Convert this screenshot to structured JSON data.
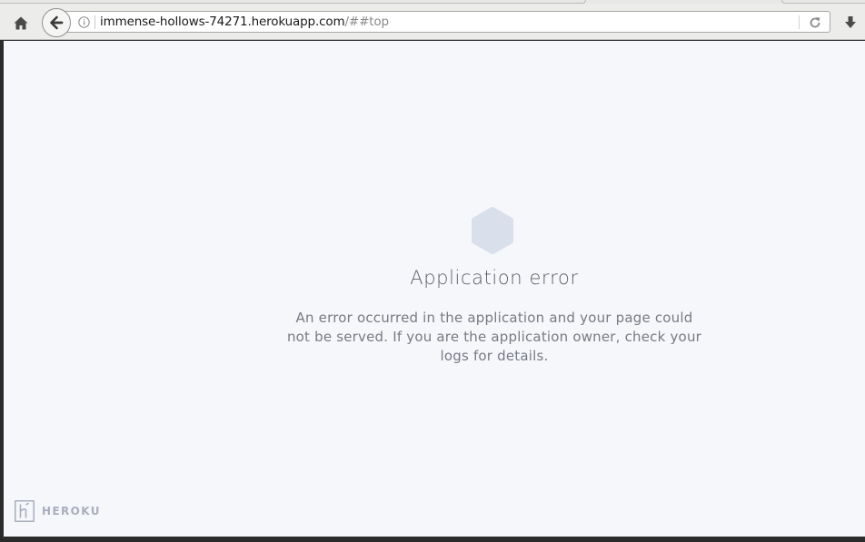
{
  "browser": {
    "url_host": "immense-hollows-74271.herokuapp.com",
    "url_rest": "/##top",
    "icons": {
      "home": "home-icon",
      "back": "back-arrow-icon",
      "info": "info-icon",
      "reload": "reload-icon",
      "download": "download-icon"
    }
  },
  "page": {
    "title": "Application error",
    "message": "An error occurred in the application and your page could not be served. If you are the application owner, check your logs for details.",
    "logo_text": "HEROKU",
    "colors": {
      "background": "#f6f7fa",
      "hexagon": "#dadfec",
      "title": "#5d5f68",
      "message": "#787a85",
      "logo": "#a9adbd"
    }
  }
}
